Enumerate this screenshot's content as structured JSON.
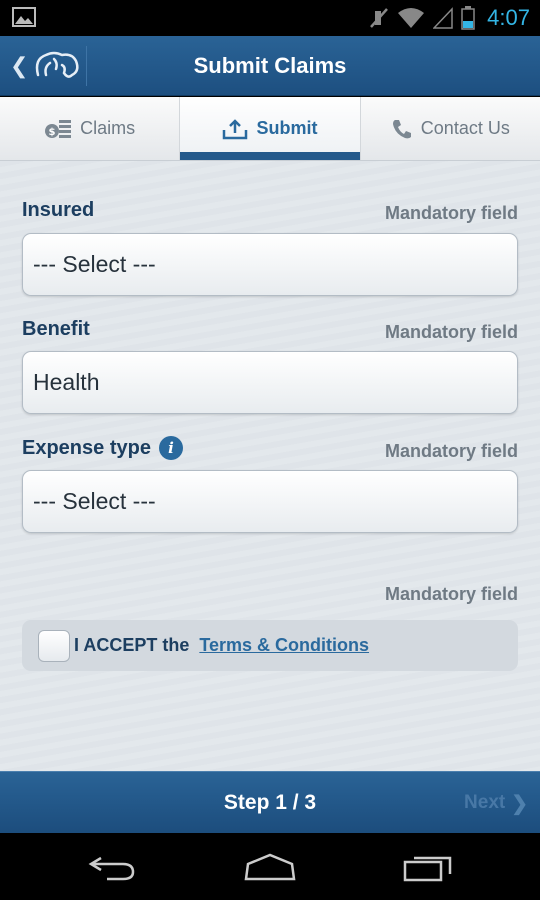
{
  "status_bar": {
    "time": "4:07",
    "icons": [
      "gallery-icon",
      "mute-icon",
      "wifi-icon",
      "signal-icon",
      "battery-icon"
    ]
  },
  "header": {
    "title": "Submit Claims",
    "back_icon": "chevron-left-icon",
    "logo_icon": "elephant-logo-icon"
  },
  "tabs": [
    {
      "label": "Claims",
      "icon": "coins-icon",
      "active": false
    },
    {
      "label": "Submit",
      "icon": "upload-icon",
      "active": true
    },
    {
      "label": "Contact Us",
      "icon": "phone-icon",
      "active": false
    }
  ],
  "form": {
    "insured": {
      "label": "Insured",
      "mandatory": "Mandatory field",
      "value": "--- Select ---"
    },
    "benefit": {
      "label": "Benefit",
      "mandatory": "Mandatory field",
      "value": "Health"
    },
    "expense_type": {
      "label": "Expense type",
      "mandatory": "Mandatory field",
      "value": "--- Select ---",
      "info_icon": "info-icon"
    },
    "terms": {
      "mandatory": "Mandatory field",
      "accept_text": "I ACCEPT the",
      "link_text": "Terms & Conditions",
      "checked": false
    }
  },
  "footer": {
    "step": "Step 1 / 3",
    "next_label": "Next",
    "next_chevron": "❯"
  },
  "colors": {
    "header_blue": "#24598b",
    "active_tab": "#2a6a9e",
    "label_navy": "#1c3e60",
    "clock_cyan": "#33b5e5"
  }
}
